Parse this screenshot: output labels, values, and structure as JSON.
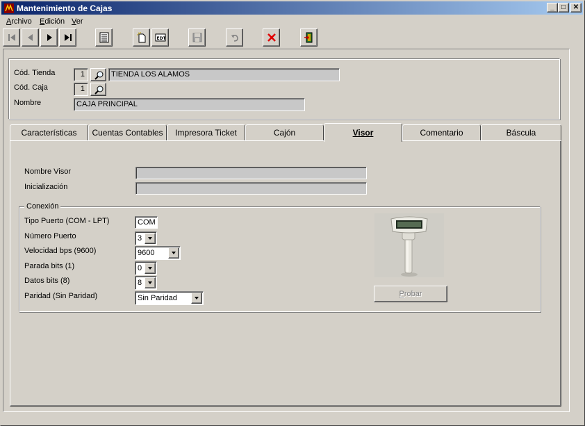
{
  "window": {
    "title": "Mantenimiento de Cajas",
    "controls": [
      "minimize",
      "maximize",
      "close"
    ]
  },
  "menu": {
    "items": [
      {
        "label": "Archivo",
        "mnemonic": "A"
      },
      {
        "label": "Edición",
        "mnemonic": "E"
      },
      {
        "label": "Ver",
        "mnemonic": "V"
      }
    ]
  },
  "toolbar": {
    "icons": [
      "first-record-icon",
      "previous-record-icon",
      "next-record-icon",
      "last-record-icon",
      "list-icon",
      "new-record-icon",
      "edit-record-icon",
      "save-icon",
      "undo-icon",
      "delete-icon",
      "exit-icon"
    ]
  },
  "header": {
    "tienda_label": "Cód. Tienda",
    "tienda_code": "1",
    "tienda_name": "TIENDA LOS ALAMOS",
    "caja_label": "Cód. Caja",
    "caja_code": "1",
    "nombre_label": "Nombre",
    "nombre_value": "CAJA PRINCIPAL"
  },
  "tabs": [
    {
      "label": "Características",
      "active": false
    },
    {
      "label": "Cuentas Contables",
      "active": false
    },
    {
      "label": "Impresora Ticket",
      "active": false
    },
    {
      "label": "Cajón",
      "active": false
    },
    {
      "label": "Visor",
      "active": true
    },
    {
      "label": "Comentario",
      "active": false
    },
    {
      "label": "Báscula",
      "active": false
    }
  ],
  "visor": {
    "nombre_visor_label": "Nombre Visor",
    "nombre_visor_value": "",
    "inicializacion_label": "Inicialización",
    "inicializacion_value": "",
    "conexion_group": "Conexión",
    "tipo_puerto_label": "Tipo Puerto (COM - LPT)",
    "tipo_puerto_value": "COM",
    "numero_puerto_label": "Número Puerto",
    "numero_puerto_value": "3",
    "velocidad_label": "Velocidad bps (9600)",
    "velocidad_value": "9600",
    "parada_label": "Parada bits (1)",
    "parada_value": "0",
    "datos_label": "Datos bits (8)",
    "datos_value": "8",
    "paridad_label": "Paridad (Sin Paridad)",
    "paridad_value": "Sin Paridad",
    "probar_label": "Probar",
    "probar_mnemonic": "P"
  }
}
